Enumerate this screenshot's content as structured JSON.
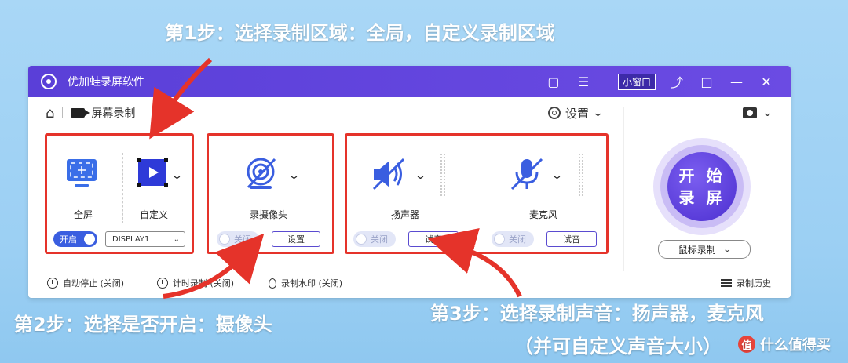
{
  "captions": {
    "step1": "第1步：选择录制区域：全局，自定义录制区域",
    "step2": "第2步：选择是否开启：摄像头",
    "step3": "第3步：选择录制声音：扬声器，麦克风",
    "step3_note": "（并可自定义声音大小）"
  },
  "watermark": {
    "logo": "值",
    "text": "什么值得买"
  },
  "app": {
    "title": "优加蛙录屏软件",
    "mini_window": "小窗口",
    "colors": {
      "titlebar": "#5a3fd8",
      "highlight": "#e5332a",
      "accent": "#3a5ee0"
    }
  },
  "toolbar": {
    "breadcrumb": "屏幕录制",
    "settings_label": "设置"
  },
  "region": {
    "fullscreen_label": "全屏",
    "custom_label": "自定义",
    "toggle_label": "开启",
    "display_value": "DISPLAY1"
  },
  "camera": {
    "label": "录摄像头",
    "toggle_label": "关闭",
    "settings_button": "设置"
  },
  "speaker": {
    "label": "扬声器",
    "toggle_label": "关闭",
    "test_button": "试音"
  },
  "mic": {
    "label": "麦克风",
    "toggle_label": "关闭",
    "test_button": "试音"
  },
  "start": {
    "line1": "开 始",
    "line2": "录 屏",
    "mouse_mode": "鼠标录制"
  },
  "footer": {
    "auto_stop": "自动停止 (关闭)",
    "timer": "计时录制 (关闭)",
    "watermark": "录制水印 (关闭)",
    "history": "录制历史"
  }
}
